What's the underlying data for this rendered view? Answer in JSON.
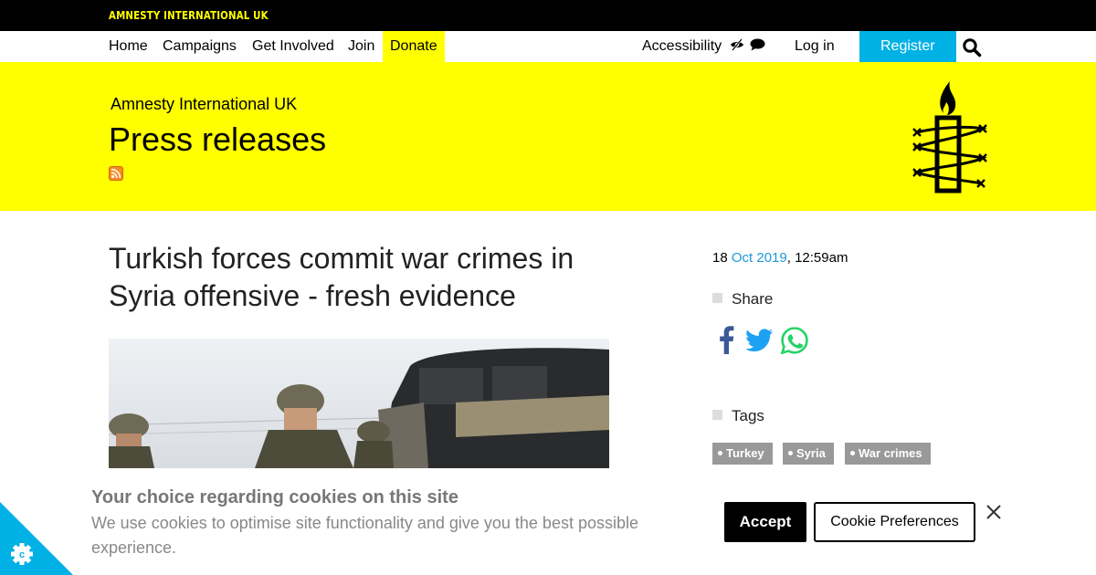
{
  "topbar": {
    "brand": "AMNESTY INTERNATIONAL UK"
  },
  "nav": {
    "items": [
      {
        "label": "Home"
      },
      {
        "label": "Campaigns"
      },
      {
        "label": "Get Involved"
      },
      {
        "label": "Join"
      },
      {
        "label": "Donate"
      }
    ],
    "accessibility_label": "Accessibility",
    "login_label": "Log in",
    "register_label": "Register",
    "icons": {
      "accessibility": "eye-slash-icon",
      "chat": "comment-icon",
      "search": "search-icon"
    }
  },
  "banner": {
    "org_name": "Amnesty International UK",
    "section_title": "Press releases",
    "rss_icon": "rss-icon",
    "logo": "candle-barbed-wire-logo"
  },
  "article": {
    "title": "Turkish forces commit war crimes in Syria offensive - fresh evidence",
    "date_day": "18",
    "date_month_year": "Oct 2019",
    "date_time": ", 12:59am"
  },
  "sidebar": {
    "share_heading": "Share",
    "share_icons": [
      "facebook-icon",
      "twitter-icon",
      "whatsapp-icon"
    ],
    "tags_heading": "Tags",
    "tags": [
      "Turkey",
      "Syria",
      "War crimes"
    ]
  },
  "cookie_banner": {
    "heading": "Your choice regarding cookies on this site",
    "description": "We use cookies to optimise site functionality and give you the best possible experience.",
    "accept_label": "Accept",
    "preferences_label": "Cookie Preferences"
  },
  "colors": {
    "brand_yellow": "#ffff00",
    "link_blue": "#1d9ad6",
    "register_blue": "#00b1e5",
    "facebook": "#3b5998",
    "twitter": "#1da1f2",
    "whatsapp": "#25d366",
    "cookie_badge": "#00b1e5"
  }
}
